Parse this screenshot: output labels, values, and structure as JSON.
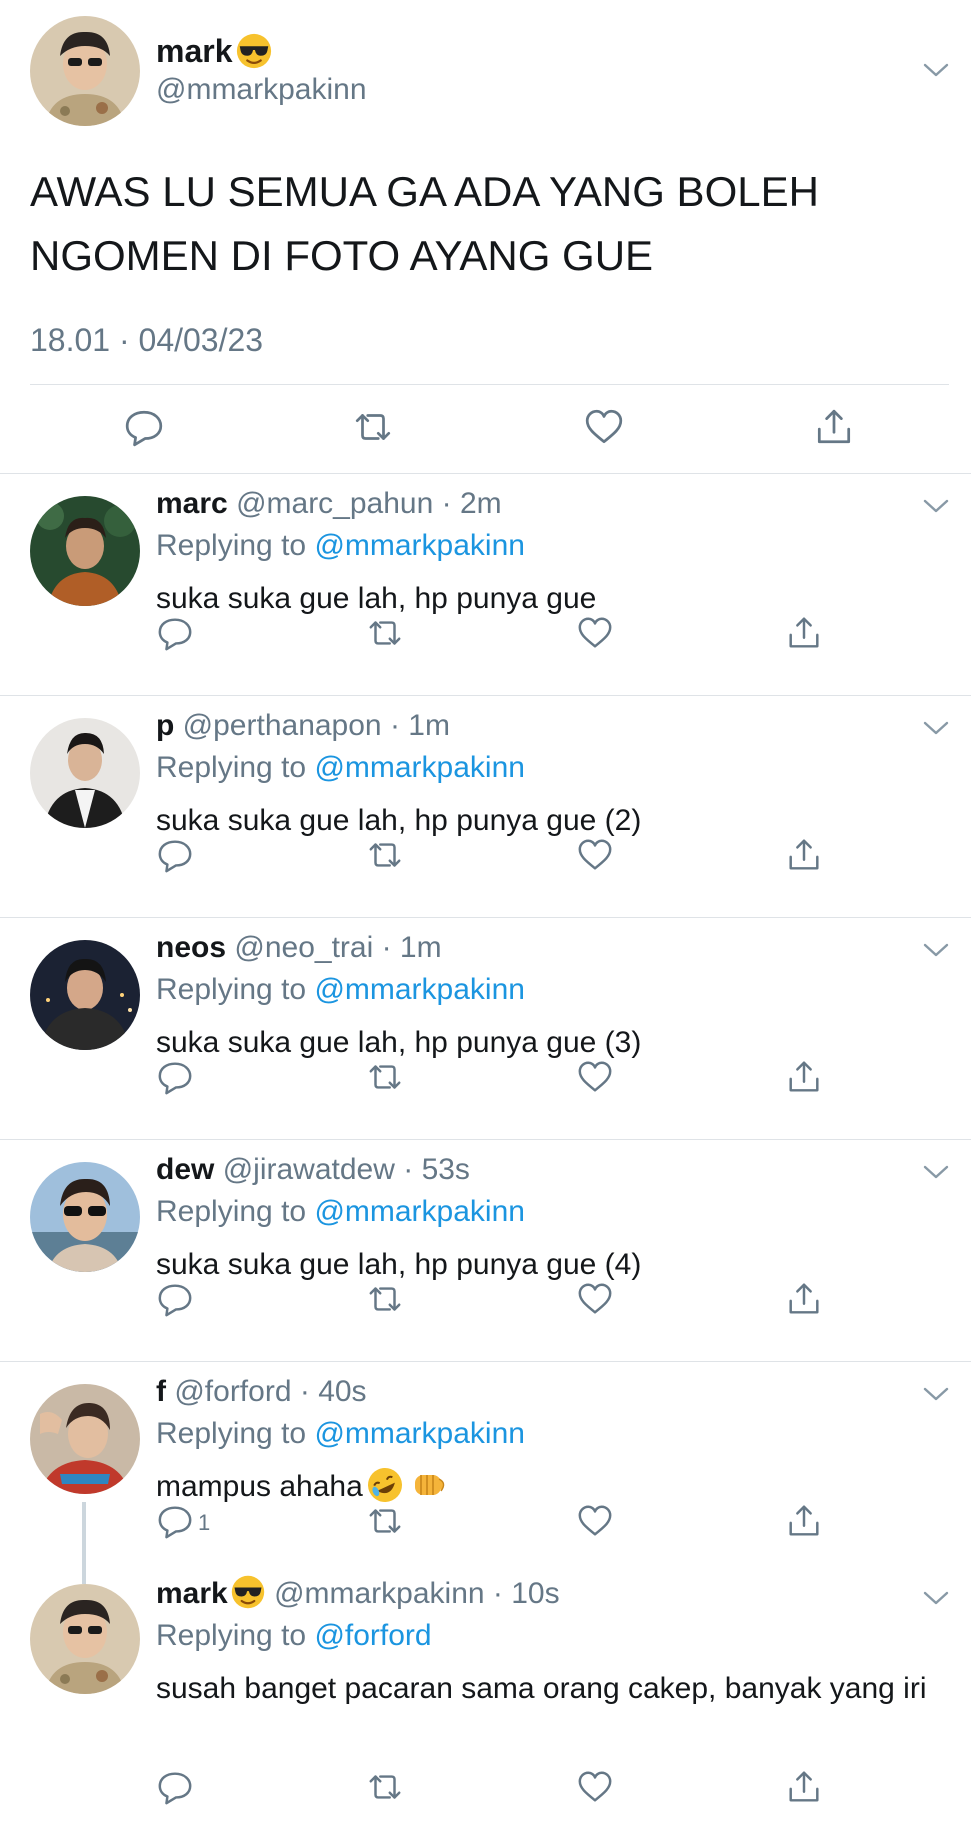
{
  "main_tweet": {
    "name": "mark",
    "name_emoji": "sunglasses-emoji",
    "handle": "@mmarkpakinn",
    "text": "AWAS LU SEMUA GA ADA YANG BOLEH NGOMEN DI FOTO AYANG GUE",
    "timestamp": "18.01 · 04/03/23"
  },
  "replies": [
    {
      "name": "marc",
      "handle": "@marc_pahun",
      "time": "2m",
      "replying_label": "Replying to",
      "mention": "@mmarkpakinn",
      "text": "suka suka gue lah, hp punya gue",
      "reply_count": ""
    },
    {
      "name": "p",
      "handle": "@perthanapon",
      "time": "1m",
      "replying_label": "Replying to",
      "mention": "@mmarkpakinn",
      "text": "suka suka gue lah, hp punya gue (2)",
      "reply_count": ""
    },
    {
      "name": "neos",
      "handle": "@neo_trai",
      "time": "1m",
      "replying_label": "Replying to",
      "mention": "@mmarkpakinn",
      "text": "suka suka gue lah, hp punya gue (3)",
      "reply_count": ""
    },
    {
      "name": "dew",
      "handle": "@jirawatdew",
      "time": "53s",
      "replying_label": "Replying to",
      "mention": "@mmarkpakinn",
      "text": "suka suka gue lah, hp punya gue (4)",
      "reply_count": ""
    },
    {
      "name": "f",
      "handle": "@forford",
      "time": "40s",
      "replying_label": "Replying to",
      "mention": "@mmarkpakinn",
      "text": "mampus ahaha",
      "reply_count": "1",
      "emojis": [
        "rofl-emoji",
        "fist-emoji"
      ]
    },
    {
      "name": "mark",
      "handle": "@mmarkpakinn",
      "time": "10s",
      "replying_label": "Replying to",
      "mention": "@forford",
      "text": "susah banget pacaran sama orang cakep, banyak yang iri",
      "reply_count": "",
      "name_emoji": "sunglasses-emoji"
    }
  ],
  "colors": {
    "text": "#14171a",
    "muted": "#657786",
    "link": "#1b95e0",
    "separator": "#dfe3e7",
    "icon": "#657786"
  }
}
